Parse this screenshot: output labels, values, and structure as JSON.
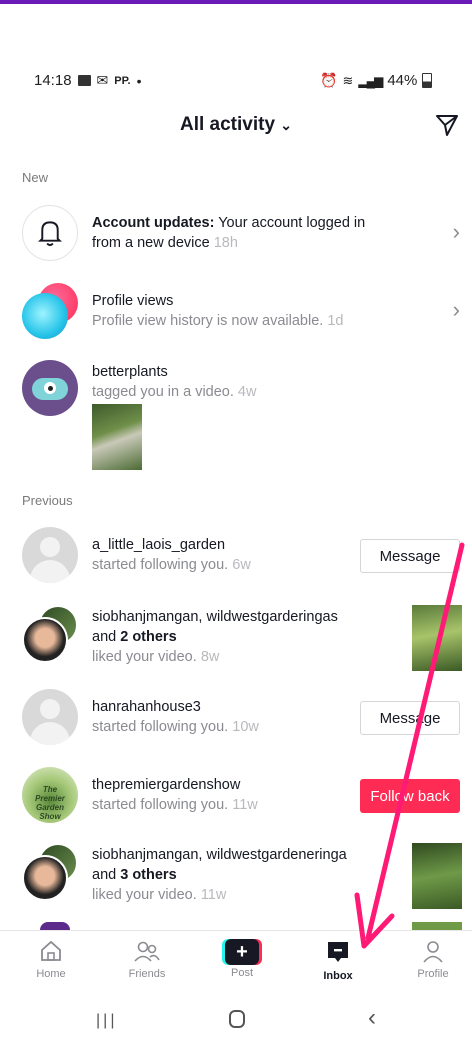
{
  "status_bar": {
    "time": "14:18",
    "left_extra": "PP.",
    "battery": "44%"
  },
  "header": {
    "title": "All activity",
    "title_icon": "chevron-down-icon",
    "right_icon": "filter-icon"
  },
  "sections": {
    "new_label": "New",
    "previous_label": "Previous"
  },
  "new_items": [
    {
      "name": "Account updates:",
      "text": " Your account logged in from a new device",
      "time": "18h"
    },
    {
      "name": "Profile views",
      "text": "Profile view history is now available.",
      "time": "1d"
    },
    {
      "name": "betterplants",
      "text": "tagged you in a video.",
      "time": "4w"
    }
  ],
  "previous_items": [
    {
      "name": "a_little_laois_garden",
      "text": "started following you.",
      "time": "6w",
      "action": "Message"
    },
    {
      "name": "siobhanjmangan, wildwestgarderingas",
      "line2_pre": "and ",
      "line2_bold": "2 others",
      "text": "liked your video.",
      "time": "8w"
    },
    {
      "name": "hanrahanhouse3",
      "text": "started following you.",
      "time": "10w",
      "action": "Message"
    },
    {
      "name": "thepremiergardenshow",
      "text": "started following you.",
      "time": "11w",
      "action": "Follow back"
    },
    {
      "name": "siobhanjmangan, wildwestgardeneringa",
      "line2_pre": "and ",
      "line2_bold": "3 others",
      "text": "liked your video.",
      "time": "11w"
    }
  ],
  "nav": {
    "home": "Home",
    "friends": "Friends",
    "post": "Post",
    "inbox": "Inbox",
    "profile": "Profile"
  },
  "colors": {
    "accent": "#fe2c55",
    "annotation_arrow": "#ff1a75",
    "top_border": "#6a1bb5"
  }
}
